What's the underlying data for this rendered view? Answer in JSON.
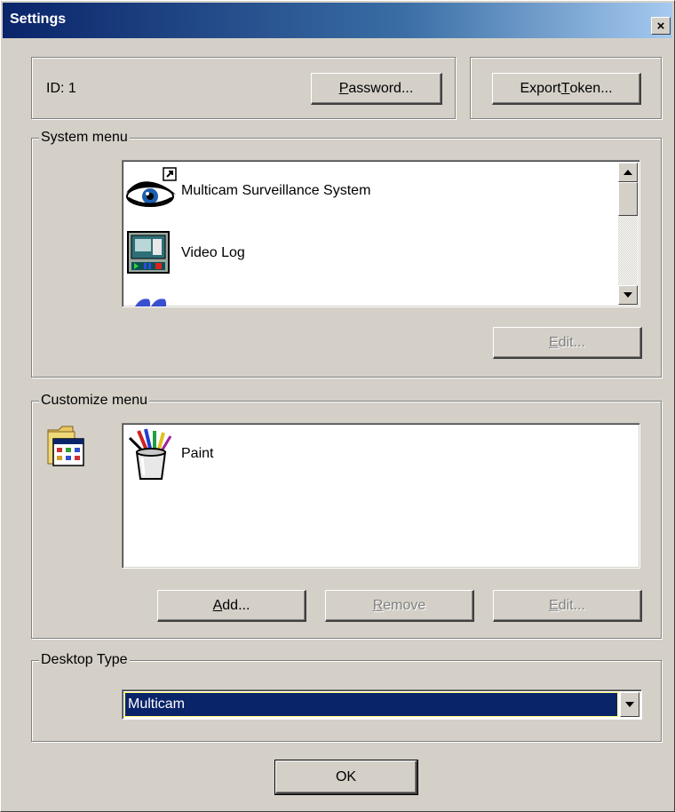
{
  "window": {
    "title": "Settings",
    "close_glyph": "×"
  },
  "account": {
    "id_label": "ID:",
    "id_value": "1",
    "password_button": {
      "before": "",
      "mnemonic": "P",
      "after": "assword..."
    },
    "export_button": {
      "before": "Export ",
      "mnemonic": "T",
      "after": "oken..."
    }
  },
  "system_menu": {
    "label": "System menu",
    "items": [
      {
        "label": "Multicam Surveillance System",
        "icon": "eye-shortcut-icon"
      },
      {
        "label": "Video Log",
        "icon": "video-log-icon"
      },
      {
        "label": "",
        "icon": "partial-app-icon"
      }
    ],
    "edit_button": {
      "before": "",
      "mnemonic": "E",
      "after": "dit...",
      "disabled": true
    }
  },
  "customize_menu": {
    "label": "Customize menu",
    "folder_icon": "program-folder-icon",
    "items": [
      {
        "label": "Paint",
        "icon": "paint-icon"
      }
    ],
    "add_button": {
      "before": "",
      "mnemonic": "A",
      "after": "dd...",
      "disabled": false
    },
    "remove_button": {
      "before": "",
      "mnemonic": "R",
      "after": "emove",
      "disabled": true
    },
    "edit_button": {
      "before": "",
      "mnemonic": "E",
      "after": "dit...",
      "disabled": true
    }
  },
  "desktop_type": {
    "label": "Desktop Type",
    "selected": "Multicam"
  },
  "ok_button": "OK",
  "colors": {
    "face": "#d4d0c8",
    "title_start": "#0a246a",
    "selection": "#0a246a",
    "disabled_text": "#808080"
  }
}
